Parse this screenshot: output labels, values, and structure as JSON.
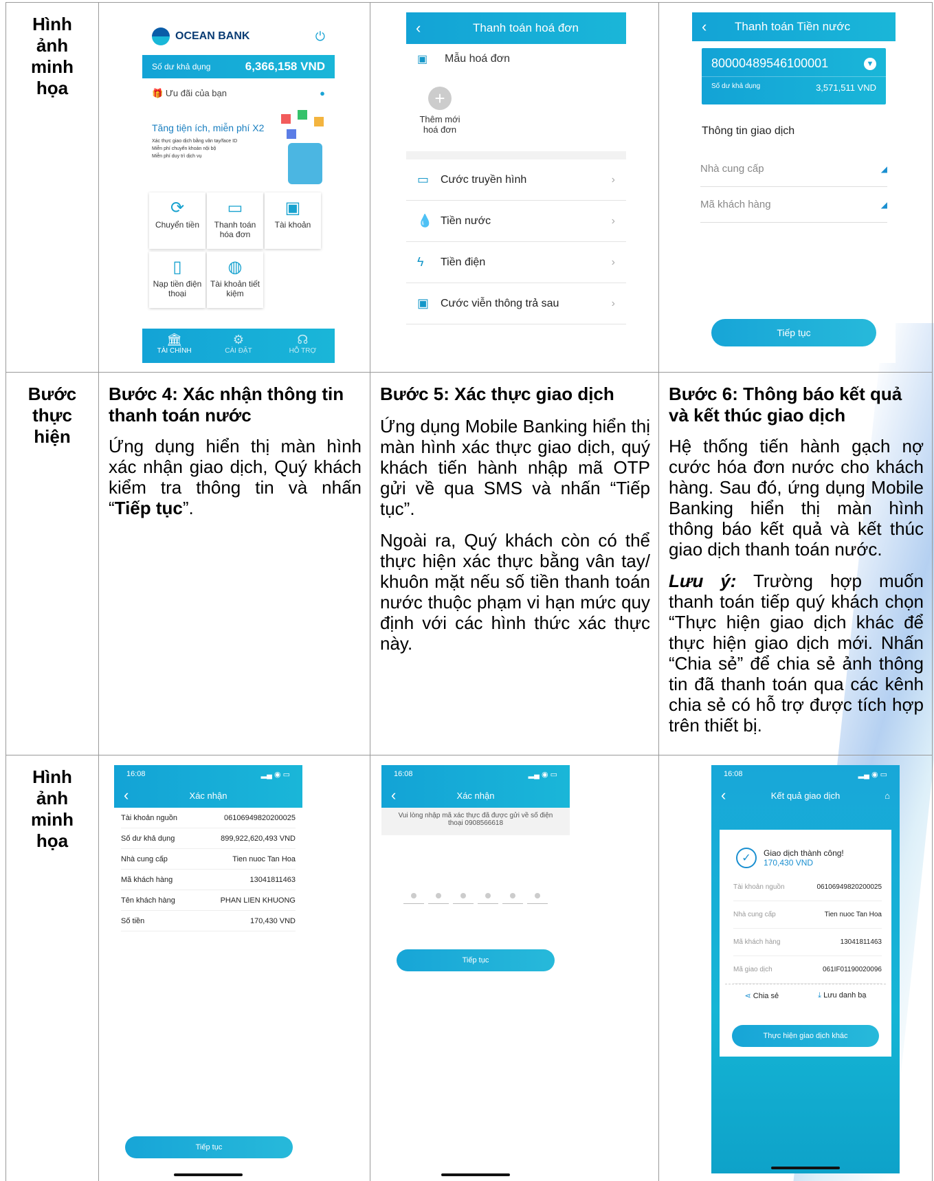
{
  "row_labels": {
    "illustration": "Hình ảnh minh họa",
    "steps": "Bước thực hiện"
  },
  "screen1": {
    "logo": "OCEAN BANK",
    "balance_label": "Số dư khả dụng",
    "balance_value": "6,366,158 VND",
    "offers": "Ưu đãi của bạn",
    "promo_title": "Tăng tiện ích, miễn phí X2",
    "promo_items": [
      "Xác thực giao dịch bằng vân tay/face ID",
      "Miễn phí chuyển khoản nội bộ",
      "Miễn phí duy trì dịch vụ"
    ],
    "tiles": [
      "Chuyển tiền",
      "Thanh toán hóa đơn",
      "Tài khoản",
      "Nạp tiền điện thoại",
      "Tài khoản tiết kiệm"
    ],
    "nav": [
      "TÀI CHÍNH",
      "CÀI ĐẶT",
      "HỖ TRỢ"
    ]
  },
  "screen2": {
    "title": "Thanh toán hoá đơn",
    "template": "Mẫu hoá đơn",
    "add": "Thêm mới hoá đơn",
    "items": [
      "Cước truyền hình",
      "Tiền nước",
      "Tiền điện",
      "Cước viễn thông trả sau"
    ]
  },
  "screen3": {
    "title": "Thanh toán Tiền nước",
    "account": "80000489546100001",
    "balance_label": "Số dư khả dụng",
    "balance_value": "3,571,511 VND",
    "section": "Thông tin giao dịch",
    "field1": "Nhà cung cấp",
    "field2": "Mã khách hàng",
    "button": "Tiếp tục"
  },
  "steps": [
    {
      "title": "Bước 4: Xác nhận thông tin thanh toán nước",
      "body_pre": "Ứng dụng hiển thị màn hình xác nhận giao dịch, Quý khách kiểm tra thông tin và nhấn “",
      "body_bold": "Tiếp tục",
      "body_post": "”."
    },
    {
      "title": "Bước 5: Xác thực giao dịch",
      "p1": "Ứng dụng Mobile Banking hiển thị màn hình xác thực giao dịch, quý khách tiến hành nhập mã OTP gửi về qua SMS và nhấn “Tiếp tục”.",
      "p2": "Ngoài ra, Quý khách còn có thể thực hiện xác thực bằng vân tay/ khuôn mặt nếu số tiền thanh toán nước thuộc phạm vi hạn mức quy định với các hình thức xác thực này."
    },
    {
      "title": "Bước 6: Thông báo kết quả và kết thúc giao dịch",
      "p1": "Hệ thống tiến hành gạch nợ cước hóa đơn nước cho khách hàng. Sau đó, ứng dụng Mobile Banking hiển thị màn hình thông báo kết quả và kết thúc giao dịch thanh toán nước.",
      "note_label": "Lưu ý:",
      "p2": " Trường hợp muốn thanh toán tiếp quý khách chọn “Thực hiện giao dịch khác để thực hiện giao dịch mới. Nhấn “Chia sẻ” để chia sẻ ảnh thông tin đã thanh toán qua các kênh chia sẻ có hỗ trợ được tích hợp trên thiết bị."
    }
  ],
  "screen4": {
    "time": "16:08",
    "title": "Xác nhận",
    "rows": [
      [
        "Tài khoản nguồn",
        "06106949820200025"
      ],
      [
        "Số dư khả dụng",
        "899,922,620,493 VND"
      ],
      [
        "Nhà cung cấp",
        "Tien nuoc Tan Hoa"
      ],
      [
        "Mã khách hàng",
        "13041811463"
      ],
      [
        "Tên khách hàng",
        "PHAN LIEN KHUONG"
      ],
      [
        "Số tiền",
        "170,430 VND"
      ]
    ],
    "button": "Tiếp tục"
  },
  "screen5": {
    "time": "16:08",
    "title": "Xác nhận",
    "hint": "Vui lòng nhập mã xác thực đã được gửi về số điện thoại 0908566618",
    "button": "Tiếp tục"
  },
  "screen6": {
    "time": "16:08",
    "title": "Kết quả giao dịch",
    "success": "Giao dịch thành công!",
    "amount": "170,430 VND",
    "rows": [
      [
        "Tài khoản nguồn",
        "06106949820200025"
      ],
      [
        "Nhà cung cấp",
        "Tien nuoc Tan Hoa"
      ],
      [
        "Mã khách hàng",
        "13041811463"
      ],
      [
        "Mã giao dịch",
        "061IF01190020096"
      ]
    ],
    "share": "Chia sẻ",
    "save": "Lưu danh bạ",
    "button": "Thực hiện giao dịch khác"
  }
}
